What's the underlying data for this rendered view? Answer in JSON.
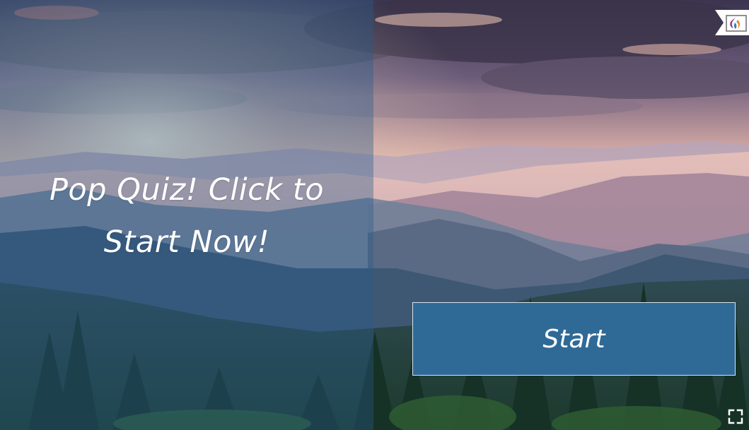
{
  "slide": {
    "title": "Pop Quiz! Click to Start Now!",
    "start_label": "Start"
  },
  "icons": {
    "logo": "flame-logo-icon",
    "fullscreen": "fullscreen-icon"
  },
  "colors": {
    "panel_tint": "#285c8c",
    "button_fill": "#2f6a97",
    "button_border": "#d8e4ee",
    "text": "#ffffff"
  }
}
